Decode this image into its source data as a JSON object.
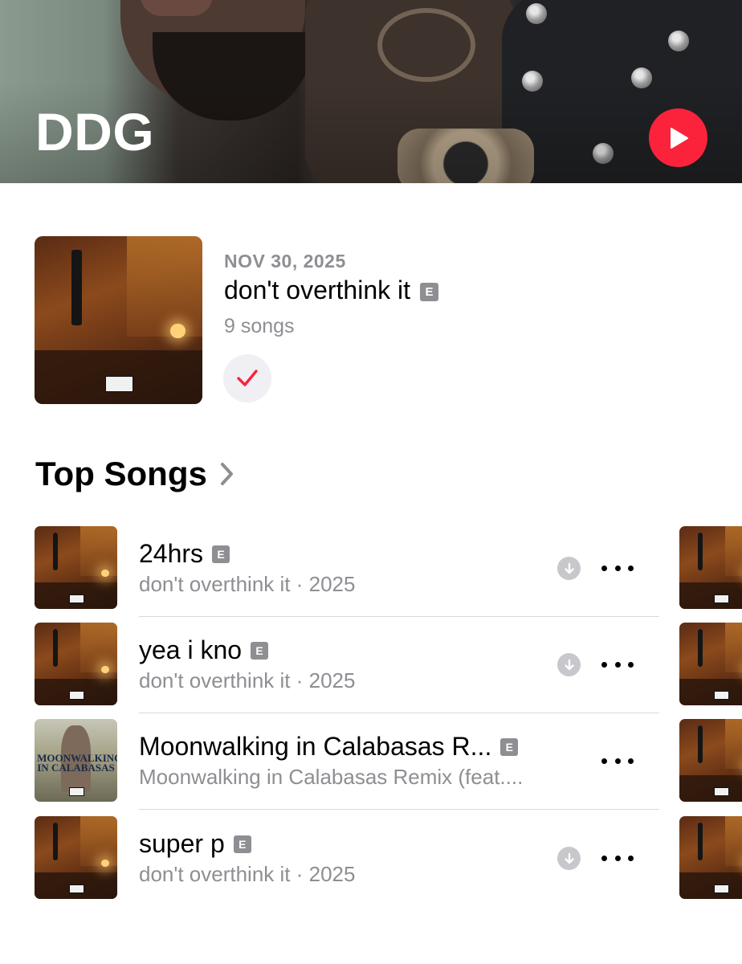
{
  "artist": {
    "name": "DDG"
  },
  "latest_release": {
    "date": "NOV 30, 2025",
    "title": "don't overthink it",
    "explicit_badge": "E",
    "song_count": "9 songs",
    "in_library": true
  },
  "top_songs": {
    "heading": "Top Songs",
    "songs": [
      {
        "title": "24hrs",
        "explicit_badge": "E",
        "subtitle": "don't overthink it · 2025",
        "download_icon": "download-circle-icon"
      },
      {
        "title": "yea i kno",
        "explicit_badge": "E",
        "subtitle": "don't overthink it · 2025",
        "download_icon": "download-circle-icon"
      },
      {
        "title": "Moonwalking in Calabasas R...",
        "explicit_badge": "E",
        "subtitle": "Moonwalking in Calabasas Remix (feat....",
        "artwork_text": "MOONWALKING IN CALABASAS"
      },
      {
        "title": "super p",
        "explicit_badge": "E",
        "subtitle": "don't overthink it · 2025",
        "download_icon": "download-circle-icon"
      }
    ]
  },
  "colors": {
    "accent": "#fa233b",
    "secondary_text": "#8e8e93",
    "badge": "#8e8e93",
    "divider": "#d9d9dc"
  },
  "icons": {
    "play": "play-icon",
    "added": "checkmark-icon",
    "more": "ellipsis-icon",
    "section": "chevron-right-icon"
  }
}
